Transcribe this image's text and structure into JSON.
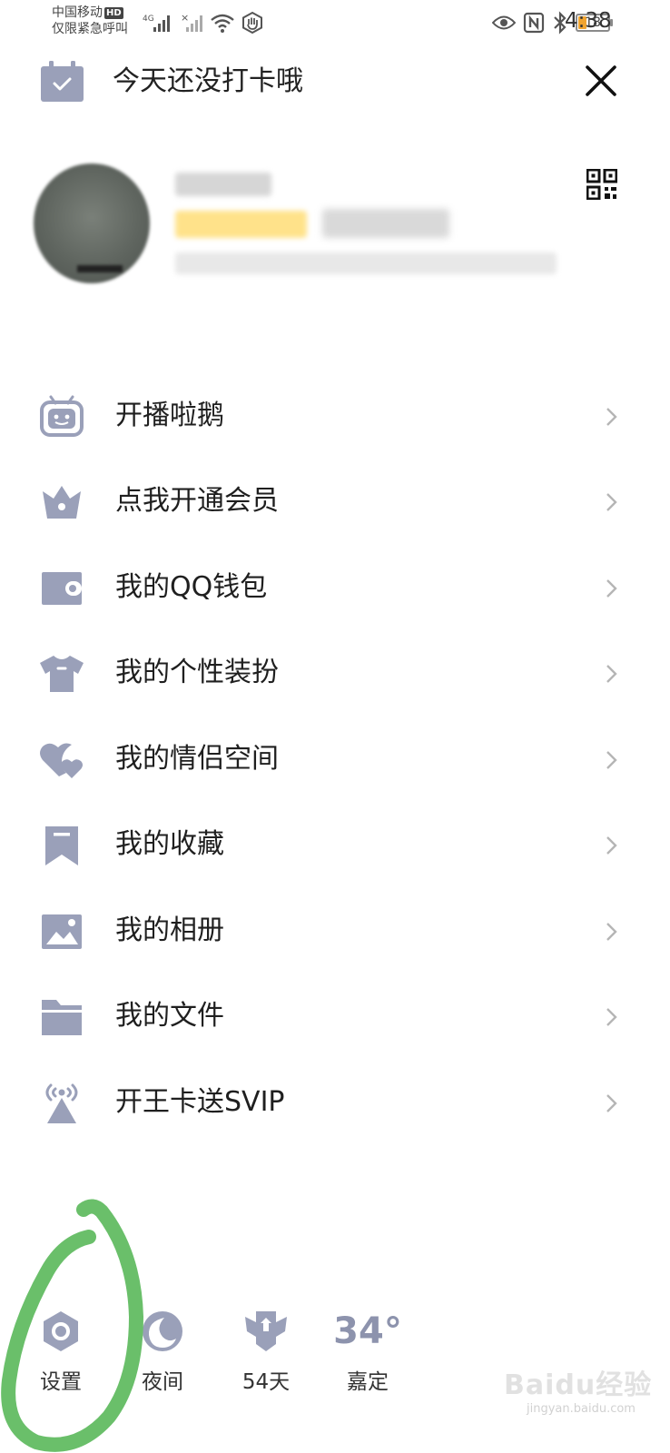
{
  "status_bar": {
    "carrier_line1": "中国移动",
    "carrier_hd": "HD",
    "carrier_line2": "仅限紧急呼叫",
    "network": "4G",
    "battery": "18",
    "time": "4:38"
  },
  "header": {
    "title": "今天还没打卡哦",
    "icons": {
      "calendar": "calendar-check-icon",
      "close": "close-icon"
    }
  },
  "profile": {
    "qr_icon": "qr-code-icon"
  },
  "menu": [
    {
      "label": "开播啦鹅",
      "icon": "live-tv-icon"
    },
    {
      "label": "点我开通会员",
      "icon": "crown-icon"
    },
    {
      "label": "我的QQ钱包",
      "icon": "wallet-icon"
    },
    {
      "label": "我的个性装扮",
      "icon": "tshirt-icon"
    },
    {
      "label": "我的情侣空间",
      "icon": "couple-hearts-icon"
    },
    {
      "label": "我的收藏",
      "icon": "bookmark-icon"
    },
    {
      "label": "我的相册",
      "icon": "photo-icon"
    },
    {
      "label": "我的文件",
      "icon": "folder-icon"
    },
    {
      "label": "开王卡送SVIP",
      "icon": "signal-tower-icon"
    }
  ],
  "bottom_bar": {
    "settings": {
      "label": "设置",
      "icon": "settings-hexagon-icon"
    },
    "night": {
      "label": "夜间",
      "icon": "moon-icon"
    },
    "days": {
      "label": "54天",
      "icon": "winged-badge-icon"
    },
    "weather": {
      "temp": "34°",
      "label": "嘉定"
    }
  },
  "watermark": {
    "text": "Baidu经验",
    "sub": "jingyan.baidu.com"
  },
  "colors": {
    "icon": "#9aa0b9",
    "weather": "#8d93ad",
    "annotation": "#6abf6a"
  }
}
